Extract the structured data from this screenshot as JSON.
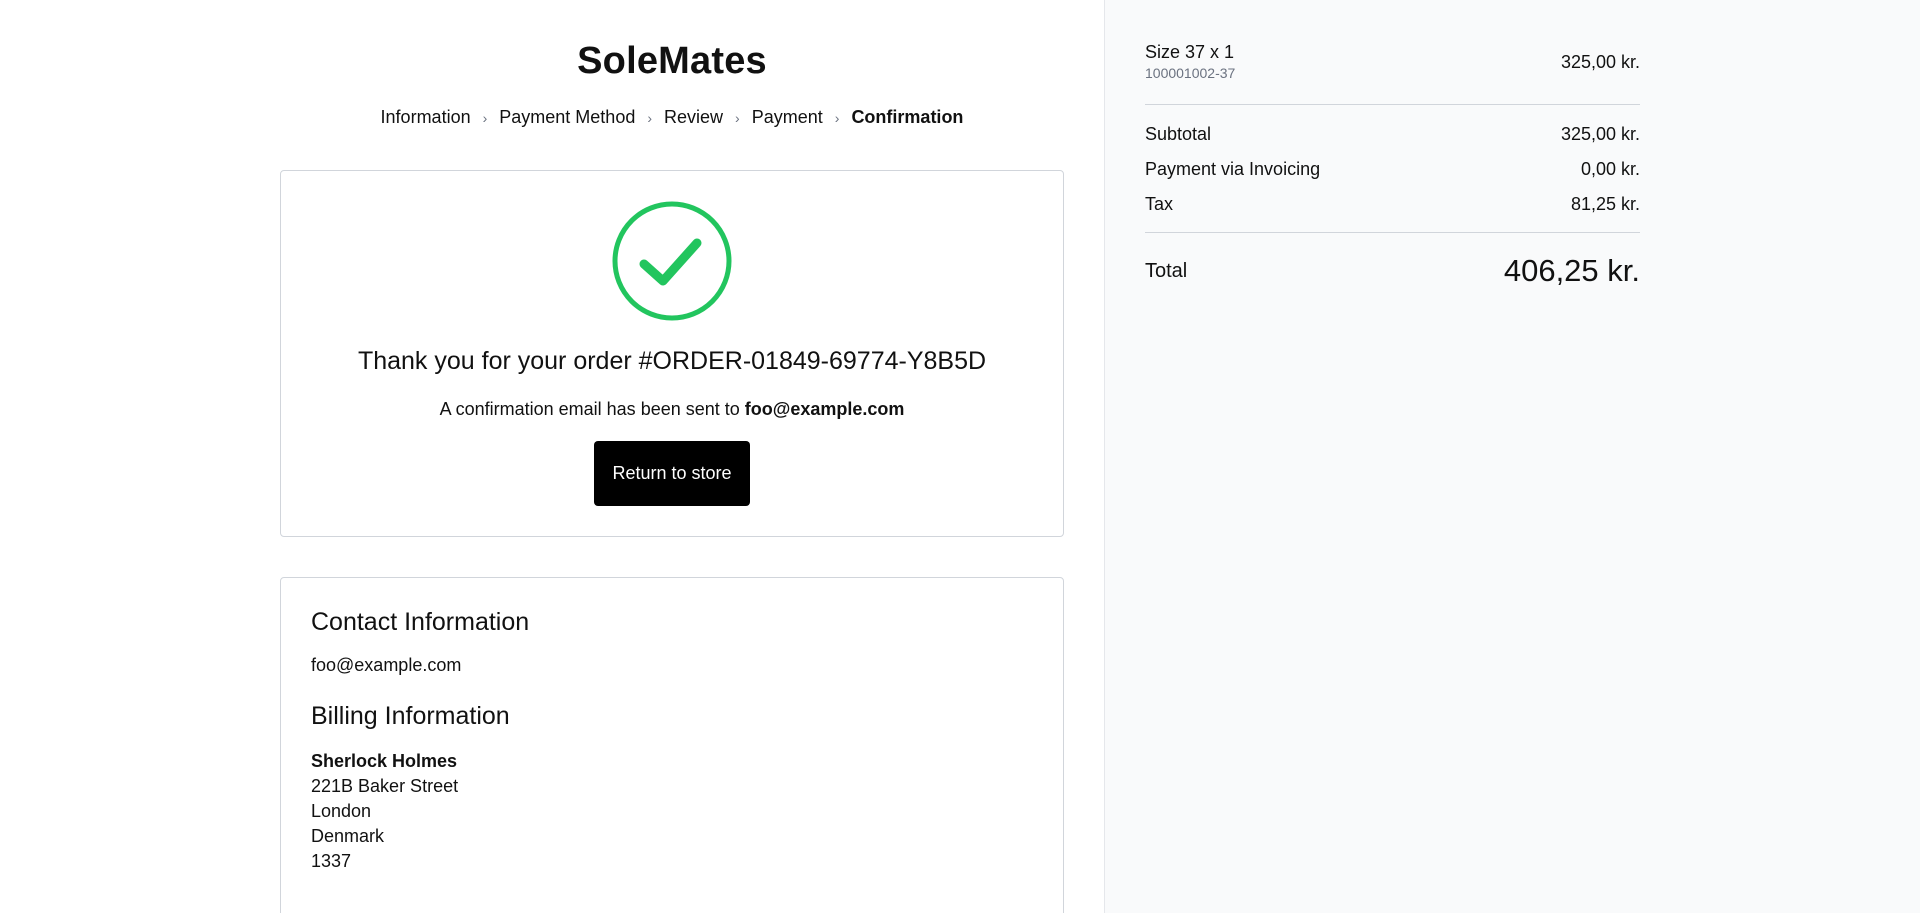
{
  "store": {
    "name": "SoleMates"
  },
  "breadcrumb": {
    "steps": [
      "Information",
      "Payment Method",
      "Review",
      "Payment",
      "Confirmation"
    ],
    "separator": "›"
  },
  "confirmation": {
    "thanks_text": "Thank you for your order #ORDER-01849-69774-Y8B5D",
    "email_prefix": "A confirmation email has been sent to",
    "email": "foo@example.com",
    "return_label": "Return to store",
    "check_color": "#22c55e"
  },
  "details": {
    "contact_heading": "Contact Information",
    "contact_email": "foo@example.com",
    "billing_heading": "Billing Information",
    "billing": {
      "name": "Sherlock Holmes",
      "street": "221B Baker Street",
      "city": "London",
      "country": "Denmark",
      "postal": "1337"
    }
  },
  "summary": {
    "item": {
      "name": "Size 37 x 1",
      "sku": "100001002-37",
      "price": "325,00 kr."
    },
    "subtotal_label": "Subtotal",
    "subtotal_value": "325,00 kr.",
    "payment_label": "Payment via Invoicing",
    "payment_value": "0,00 kr.",
    "tax_label": "Tax",
    "tax_value": "81,25 kr.",
    "total_label": "Total",
    "total_value": "406,25 kr."
  }
}
